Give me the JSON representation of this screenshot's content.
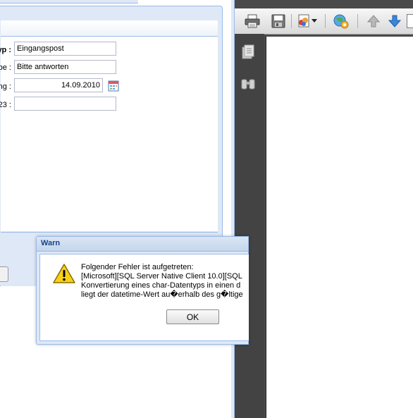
{
  "form": {
    "fields": [
      {
        "label": "yp :",
        "value": "Eingangspost"
      },
      {
        "label": "be :",
        "value": "Bitte antworten"
      },
      {
        "label": "ng :",
        "value": "14.09.2010"
      },
      {
        "label": "23 :",
        "value": ""
      }
    ]
  },
  "viewer": {
    "toolbar_icons": [
      "print-icon",
      "save-icon",
      "document-options-icon",
      "dropdown-arrow-icon",
      "globe-settings-icon",
      "arrow-up-icon",
      "arrow-down-icon"
    ],
    "side_icons": [
      "pages-icon",
      "find-icon"
    ]
  },
  "dialog": {
    "title": "Warn",
    "lines": [
      "Folgender Fehler ist aufgetreten:",
      "[Microsoft][SQL Server Native Client 10.0][SQL",
      "Konvertierung eines char-Datentyps in einen d",
      "liegt der datetime-Wert au�erhalb des g�ltige"
    ],
    "ok_label": "OK"
  },
  "colors": {
    "window_bg": "#dfe8f6",
    "window_border": "#99bbe8",
    "title_text": "#15428b",
    "viewer_dark": "#4a4a4a",
    "warning_yellow": "#f7d117"
  }
}
